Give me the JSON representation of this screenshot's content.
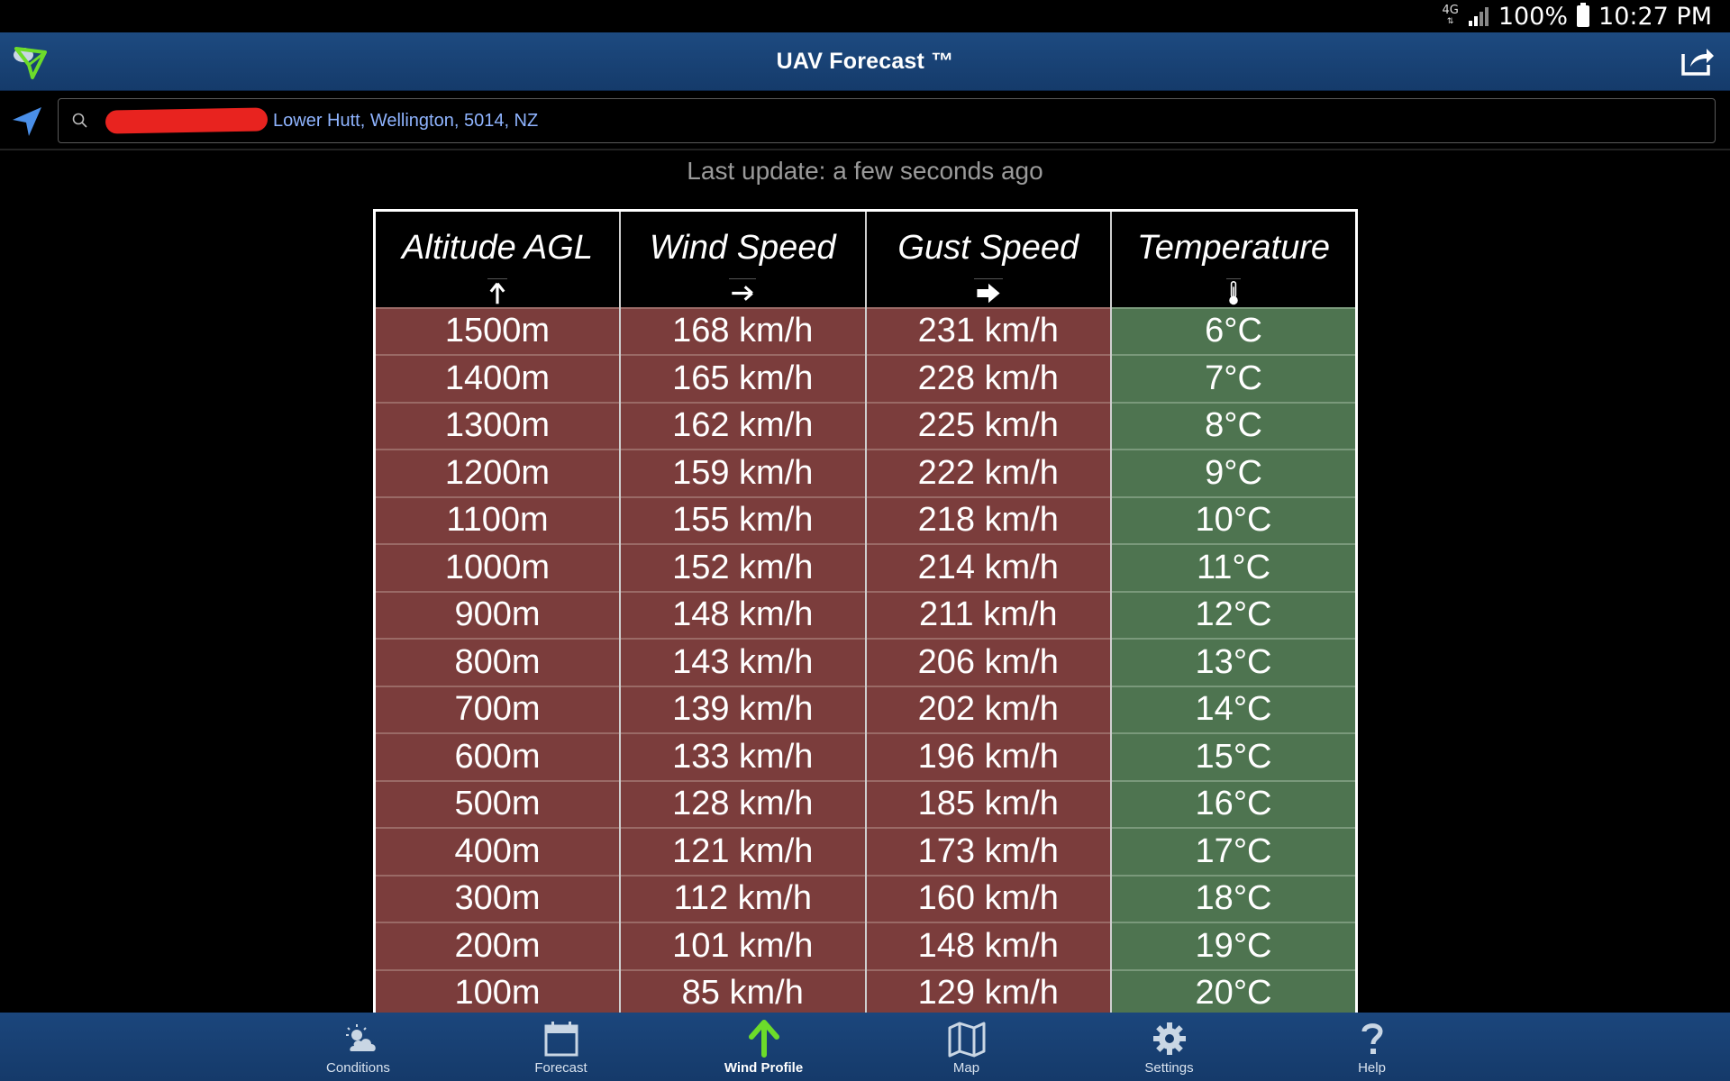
{
  "status_bar": {
    "network": "4G",
    "battery": "100%",
    "time": "10:27 PM"
  },
  "header": {
    "title": "UAV Forecast ™"
  },
  "search": {
    "value": "Lower Hutt, Wellington, 5014, NZ",
    "placeholder": ""
  },
  "last_update": "Last update: a few seconds ago",
  "table": {
    "headers": [
      "Altitude AGL",
      "Wind Speed",
      "Gust Speed",
      "Temperature"
    ],
    "header_icons": [
      "arrow-up-icon",
      "arrow-right-icon",
      "bold-arrow-right-icon",
      "thermometer-icon"
    ],
    "rows": [
      [
        "1500m",
        "168 km/h",
        "231 km/h",
        "6°C"
      ],
      [
        "1400m",
        "165 km/h",
        "228 km/h",
        "7°C"
      ],
      [
        "1300m",
        "162 km/h",
        "225 km/h",
        "8°C"
      ],
      [
        "1200m",
        "159 km/h",
        "222 km/h",
        "9°C"
      ],
      [
        "1100m",
        "155 km/h",
        "218 km/h",
        "10°C"
      ],
      [
        "1000m",
        "152 km/h",
        "214 km/h",
        "11°C"
      ],
      [
        "900m",
        "148 km/h",
        "211 km/h",
        "12°C"
      ],
      [
        "800m",
        "143 km/h",
        "206 km/h",
        "13°C"
      ],
      [
        "700m",
        "139 km/h",
        "202 km/h",
        "14°C"
      ],
      [
        "600m",
        "133 km/h",
        "196 km/h",
        "15°C"
      ],
      [
        "500m",
        "128 km/h",
        "185 km/h",
        "16°C"
      ],
      [
        "400m",
        "121 km/h",
        "173 km/h",
        "17°C"
      ],
      [
        "300m",
        "112 km/h",
        "160 km/h",
        "18°C"
      ],
      [
        "200m",
        "101 km/h",
        "148 km/h",
        "19°C"
      ],
      [
        "100m",
        "85 km/h",
        "129 km/h",
        "20°C"
      ]
    ],
    "cell_colors": {
      "unsafe": "#7b3d3c",
      "safe": "#4e7450"
    }
  },
  "bottom_nav": [
    {
      "label": "Conditions",
      "icon": "partly-cloudy-icon",
      "active": false
    },
    {
      "label": "Forecast",
      "icon": "calendar-icon",
      "active": false
    },
    {
      "label": "Wind Profile",
      "icon": "arrow-up-icon",
      "active": true
    },
    {
      "label": "Map",
      "icon": "map-icon",
      "active": false
    },
    {
      "label": "Settings",
      "icon": "gear-icon",
      "active": false
    },
    {
      "label": "Help",
      "icon": "help-icon",
      "active": false
    }
  ],
  "colors": {
    "header_bg": "#1d4a80",
    "active_nav": "#6cdc2a",
    "location_text": "#8fb4ff"
  }
}
